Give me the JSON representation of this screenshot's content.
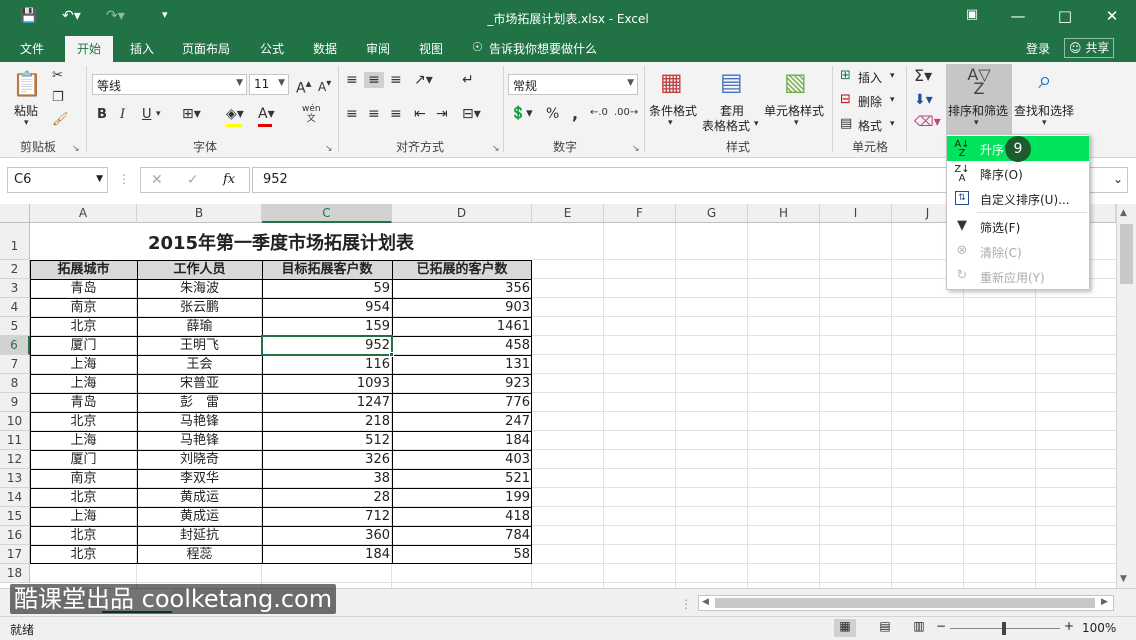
{
  "window": {
    "title": "_市场拓展计划表.xlsx - Excel",
    "minimize_icon": "minimize-icon",
    "restore_icon": "restore-icon",
    "close_icon": "close-icon"
  },
  "tabs": [
    "文件",
    "开始",
    "插入",
    "页面布局",
    "公式",
    "数据",
    "审阅",
    "视图"
  ],
  "active_tab": "开始",
  "tell_me": "告诉我你想要做什么",
  "login": "登录",
  "share": "共享",
  "ribbon": {
    "clipboard": {
      "label": "剪贴板",
      "paste": "粘贴"
    },
    "font": {
      "label": "字体",
      "name": "等线",
      "size": "11",
      "bold": "B",
      "italic": "I",
      "underline": "U",
      "grow": "A",
      "shrink": "A",
      "phonetic": "wén"
    },
    "alignment": {
      "label": "对齐方式"
    },
    "number": {
      "label": "数字",
      "format": "常规",
      "percent": "%",
      "comma": ","
    },
    "styles": {
      "label": "样式",
      "conditional": "条件格式",
      "table1": "套用",
      "table2": "表格格式",
      "cell_styles": "单元格样式"
    },
    "cells": {
      "label": "单元格",
      "insert": "插入",
      "delete": "删除",
      "format": "格式"
    },
    "editing": {
      "sort_filter": "排序和筛选",
      "find_select": "查找和选择"
    }
  },
  "formula_bar": {
    "name_box": "C6",
    "fx": "fx",
    "value": "952"
  },
  "columns": [
    "A",
    "B",
    "C",
    "D",
    "E",
    "F",
    "G",
    "H",
    "I",
    "J",
    "K",
    "L"
  ],
  "rows": [
    "1",
    "2",
    "3",
    "4",
    "5",
    "6",
    "7",
    "8",
    "9",
    "10",
    "11",
    "12",
    "13",
    "14",
    "15",
    "16",
    "17",
    "18"
  ],
  "sheet": {
    "title": "2015年第一季度市场拓展计划表",
    "headers": [
      "拓展城市",
      "工作人员",
      "目标拓展客户数",
      "已拓展的客户数"
    ],
    "data": [
      [
        "青岛",
        "朱海波",
        "59",
        "356"
      ],
      [
        "南京",
        "张云鹏",
        "954",
        "903"
      ],
      [
        "北京",
        "薛瑜",
        "159",
        "1461"
      ],
      [
        "厦门",
        "王明飞",
        "952",
        "458"
      ],
      [
        "上海",
        "王会",
        "116",
        "131"
      ],
      [
        "上海",
        "宋普亚",
        "1093",
        "923"
      ],
      [
        "青岛",
        "彭　雷",
        "1247",
        "776"
      ],
      [
        "北京",
        "马艳锋",
        "218",
        "247"
      ],
      [
        "上海",
        "马艳锋",
        "512",
        "184"
      ],
      [
        "厦门",
        "刘晓奇",
        "326",
        "403"
      ],
      [
        "南京",
        "李双华",
        "38",
        "521"
      ],
      [
        "北京",
        "黄成运",
        "28",
        "199"
      ],
      [
        "上海",
        "黄成运",
        "712",
        "418"
      ],
      [
        "北京",
        "封延抗",
        "360",
        "784"
      ],
      [
        "北京",
        "程蕊",
        "184",
        "58"
      ]
    ]
  },
  "active_cell": "C6",
  "sort_menu": {
    "step_badge": "9",
    "items": [
      {
        "label": "升序(S)",
        "icon": "sort-ascending-icon",
        "enabled": true,
        "highlighted": true
      },
      {
        "label": "降序(O)",
        "icon": "sort-descending-icon",
        "enabled": true,
        "highlighted": false
      },
      {
        "label": "自定义排序(U)...",
        "icon": "custom-sort-icon",
        "enabled": true,
        "highlighted": false
      },
      {
        "label": "筛选(F)",
        "icon": "filter-icon",
        "enabled": true,
        "highlighted": false
      },
      {
        "label": "清除(C)",
        "icon": "clear-filter-icon",
        "enabled": false,
        "highlighted": false
      },
      {
        "label": "重新应用(Y)",
        "icon": "reapply-icon",
        "enabled": false,
        "highlighted": false
      }
    ]
  },
  "status": {
    "ready": "就绪",
    "zoom": "100%"
  },
  "watermark": "酷课堂出品 coolketang.com",
  "colors": {
    "excel_green": "#217346",
    "menu_highlight": "#00e35a",
    "badge": "#1e5a2f"
  }
}
